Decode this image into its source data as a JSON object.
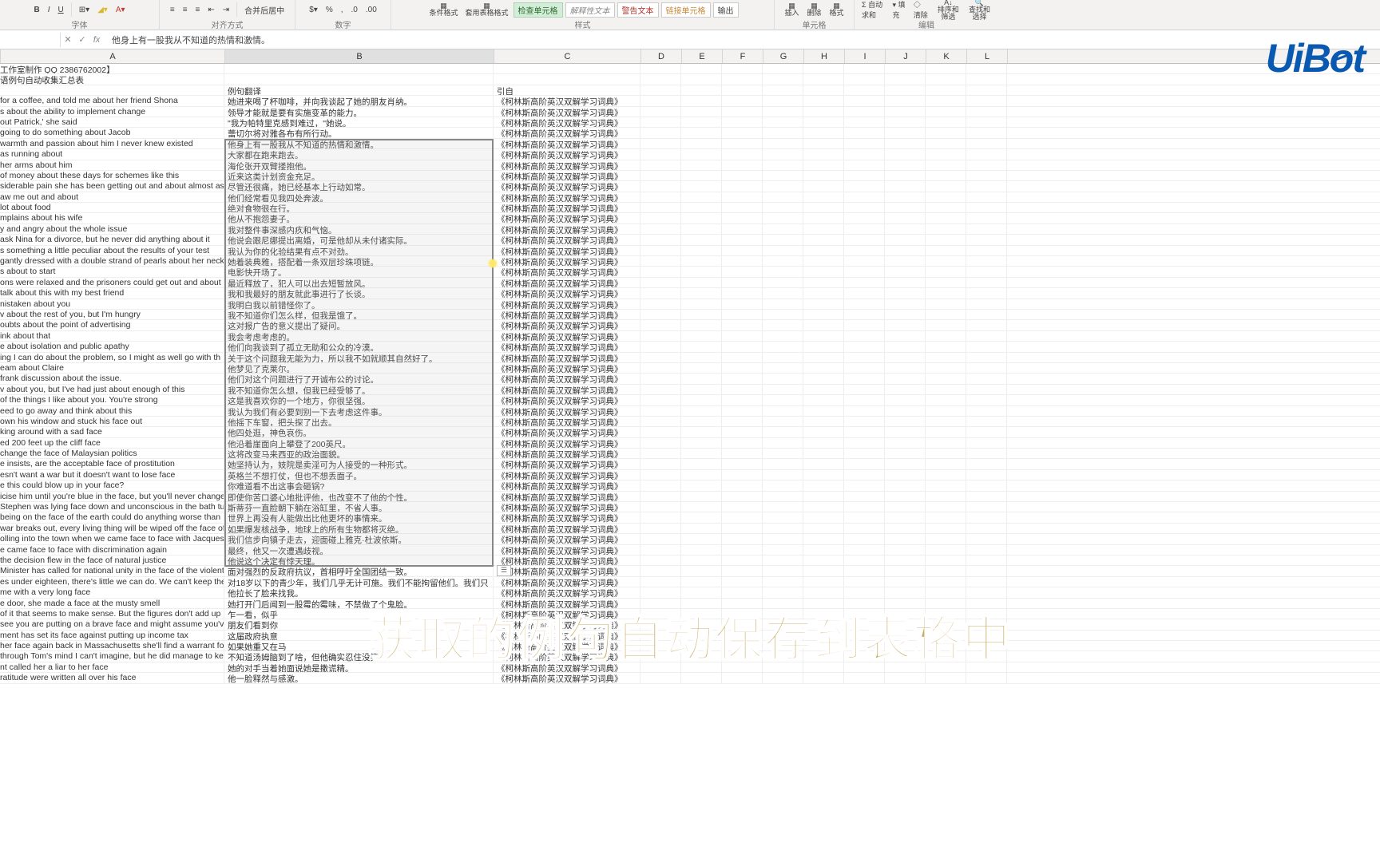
{
  "ribbon": {
    "groups": {
      "font": "字体",
      "align": "对齐方式",
      "number": "数字",
      "styles": "样式",
      "cells": "单元格",
      "editing": "编辑"
    },
    "merge": "合并后居中",
    "condfmt": "条件格式",
    "tablefmt": "套用表格格式",
    "style_boxes": [
      "检查单元格",
      "解释性文本",
      "警告文本",
      "链接单元格",
      "输出"
    ],
    "insert": "插入",
    "delete": "删除",
    "format": "格式",
    "sum": "自动求和",
    "fill": "填充",
    "clear": "清除",
    "sortfilter": "排序和筛选",
    "findselect": "查找和选择"
  },
  "formula_bar_value": "他身上有一股我从不知道的热情和激情。",
  "columns": [
    "A",
    "B",
    "C",
    "D",
    "E",
    "F",
    "G",
    "H",
    "I",
    "J",
    "K",
    "L"
  ],
  "head_row1": "工作室制作   QQ 2386762002】",
  "head_row2": "语例句自动收集汇总表",
  "header": {
    "a": "",
    "b": "例句翻译",
    "c": "引自"
  },
  "source": "《柯林斯高阶英汉双解学习词典》",
  "rows": [
    {
      "a": "for a coffee, and told me about her friend Shona",
      "b": "她进来喝了杯咖啡，并向我谈起了她的朋友肖纳。"
    },
    {
      "a": "s about the ability to implement change",
      "b": "领导才能就是要有实施变革的能力。"
    },
    {
      "a": "out Patrick,' she said",
      "b": "\"我为帕特里克感到难过，\"她说。"
    },
    {
      "a": "going to do something about Jacob",
      "b": "蕾切尔将对雅各布有所行动。"
    },
    {
      "a": " warmth and passion about him I never knew existed",
      "b": "他身上有一股我从不知道的热情和激情。"
    },
    {
      "a": "as running about",
      "b": "大家都在跑来跑去。"
    },
    {
      "a": " her arms about him",
      "b": "海伦张开双臂搂抱他。"
    },
    {
      "a": "of money about these days for schemes like this",
      "b": "近来这类计划资金充足。"
    },
    {
      "a": "siderable pain she has been getting out and about almost as ",
      "b": "尽管还很痛，她已经基本上行动如常。"
    },
    {
      "a": "aw me out and about",
      "b": "他们经常看见我四处奔波。"
    },
    {
      "a": "lot about food",
      "b": "绝对食物很在行。"
    },
    {
      "a": "mplains about his wife",
      "b": "他从不抱怨妻子。"
    },
    {
      "a": "y and angry about the whole issue",
      "b": "我对整件事深感内疚和气恼。"
    },
    {
      "a": " ask Nina for a divorce, but he never did anything about it",
      "b": "他说会跟尼娜提出离婚，可是他却从未付诸实际。"
    },
    {
      "a": "s something a little peculiar about the results of your test",
      "b": "我认为你的化验结果有点不对劲。"
    },
    {
      "a": "gantly dressed with a double strand of pearls about her neck",
      "b": "她着装典雅，搭配着一条双层珍珠项链。"
    },
    {
      "a": "s about to start",
      "b": "电影快开场了。"
    },
    {
      "a": "ons were relaxed and the prisoners could get out and about",
      "b": "最近释放了，犯人可以出去短暂放风。"
    },
    {
      "a": " talk about this with my best friend",
      "b": "我和我最好的朋友就此事进行了长谈。"
    },
    {
      "a": "nistaken about you",
      "b": "我明白我以前错怪你了。"
    },
    {
      "a": "v about the rest of you, but I'm hungry",
      "b": "我不知道你们怎么样，但我是饿了。"
    },
    {
      "a": "oubts about the point of advertising",
      "b": "这对报广告的意义提出了疑问。"
    },
    {
      "a": "ink about that",
      "b": "我会考虑考虑的。"
    },
    {
      "a": "e about isolation and public apathy",
      "b": "他们向我谈到了孤立无助和公众的冷漠。"
    },
    {
      "a": "ing I can do about the problem, so I might as well go with th",
      "b": "关于这个问题我无能为力，所以我不如就顺其自然好了。"
    },
    {
      "a": "eam about Claire",
      "b": "他梦见了克莱尔。"
    },
    {
      "a": "frank discussion about the issue.",
      "b": "他们对这个问题进行了开诚布公的讨论。"
    },
    {
      "a": "v about you, but I've had just about enough of this",
      "b": "我不知道你怎么想，但我已经受够了。"
    },
    {
      "a": "of the things I like about you. You're strong",
      "b": "这是我喜欢你的一个地方，你很坚强。"
    },
    {
      "a": "eed to go away and think about this",
      "b": "我认为我们有必要到别一下去考虑这件事。"
    },
    {
      "a": "own his window and stuck his face out",
      "b": "他摇下车窗，把头探了出去。"
    },
    {
      "a": "king around with a sad face",
      "b": "他四处逛，神色哀伤。"
    },
    {
      "a": "ed 200 feet up the cliff face",
      "b": "他沿着崖面向上攀登了200英尺。"
    },
    {
      "a": "change the face of Malaysian politics",
      "b": "这将改变马来西亚的政治面貌。"
    },
    {
      "a": "e insists, are the acceptable face of prostitution",
      "b": "她坚持认为，妓院是卖淫可为人接受的一种形式。"
    },
    {
      "a": "esn't want a war but it doesn't want to lose face",
      "b": "英格兰不想打仗，但也不想丢面子。"
    },
    {
      "a": "e this could blow up in your face?",
      "b": "你难道看不出这事会砸锅?"
    },
    {
      "a": "icise him until you're blue in the face, but you'll never change",
      "b": "即使你苦口婆心地批评他，也改变不了他的个性。"
    },
    {
      "a": "Stephen was lying face down and unconscious in the bath tu",
      "b": "斯蒂芬一直脸朝下躺在浴缸里，不省人事。"
    },
    {
      "a": "being on the face of the earth could do anything worse than ",
      "b": "世界上再没有人能做出比他更坏的事情来。"
    },
    {
      "a": "war breaks out, every living thing will be wiped off the face of",
      "b": "如果爆发核战争，地球上的所有生物都将灭绝。"
    },
    {
      "a": "olling into the town when we came face to face with Jacques",
      "b": "我们信步向镇子走去，迎面碰上雅克·杜波依斯。"
    },
    {
      "a": "e came face to face with discrimination again",
      "b": "最终，他又一次遭遇歧视。"
    },
    {
      "a": " the decision flew in the face of natural justice",
      "b": "他说这个决定有悖天理。"
    },
    {
      "a": "Minister has called for national unity in the face of the violent a",
      "b": "面对强烈的反政府抗议，首相呼吁全国团结一致。"
    },
    {
      "a": "es under eighteen, there's little we can do. We can't keep ther",
      "b": "对18岁以下的青少年，我们几乎无计可施。我们不能拘留他们。我们只"
    },
    {
      "a": "me with a very long face",
      "b": "他拉长了脸来找我。"
    },
    {
      "a": "e door, she made a face at the musty smell",
      "b": "她打开门后闻到一股霉的霉味，不禁做了个鬼脸。"
    },
    {
      "a": "of it that seems to make sense. But the figures don't add up",
      "b": "乍一看，似乎"
    },
    {
      "a": "see you are putting on a brave face and might assume you've",
      "b": "朋友们看到你"
    },
    {
      "a": "ment has set its face against putting up income tax",
      "b": "这届政府执意"
    },
    {
      "a": "her face again back in Massachusetts she'll find a warrant for",
      "b": "如果她重又在马"
    },
    {
      "a": "through Tom's mind I can't imagine, but he did manage to ke",
      "b": "不知道汤姆脑到了啥，但他确实忍住没笑。"
    },
    {
      "a": "nt called her a liar to her face",
      "b": "她的对手当着她面说她是撒谎精。"
    },
    {
      "a": "ratitude were written all over his face",
      "b": "他一脸释然与感激。"
    }
  ],
  "selection": {
    "startRow": 4,
    "endRow": 44,
    "col": "B"
  },
  "overlay_caption": "获取的例句自动保存到表格中",
  "logo_text": "UiBot"
}
